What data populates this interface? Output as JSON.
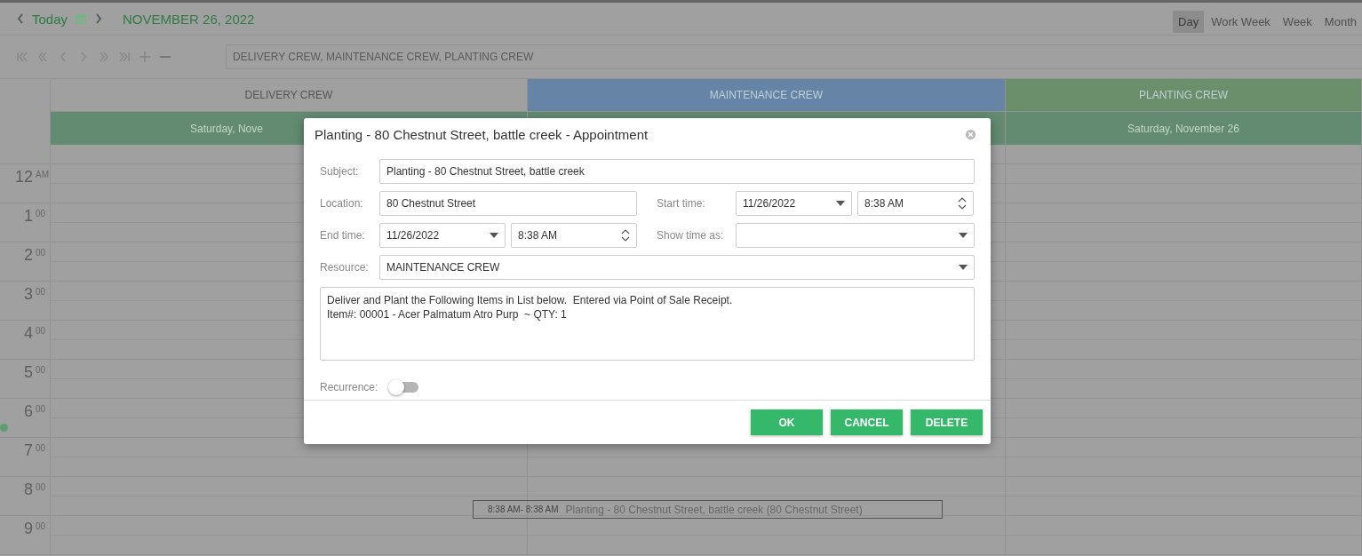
{
  "header": {
    "today": "Today",
    "date": "NOVEMBER 26, 2022",
    "views": [
      {
        "label": "Day",
        "selected": true
      },
      {
        "label": "Work Week",
        "selected": false
      },
      {
        "label": "Week",
        "selected": false
      },
      {
        "label": "Month",
        "selected": false
      }
    ]
  },
  "toolbar": {
    "resources": "DELIVERY CREW, MAINTENANCE CREW, PLANTING CREW"
  },
  "resources": [
    {
      "name": "DELIVERY CREW",
      "color": "#a0a0a0",
      "day_header": "Saturday, Nove"
    },
    {
      "name": "MAINTENANCE CREW",
      "color": "#6684a6"
    },
    {
      "name": "PLANTING CREW",
      "color": "#6a8f6a",
      "day_header": "Saturday, November 26"
    }
  ],
  "hours": [
    {
      "hour": "12",
      "suffix": "AM"
    },
    {
      "hour": "1",
      "suffix": "00"
    },
    {
      "hour": "2",
      "suffix": "00"
    },
    {
      "hour": "3",
      "suffix": "00"
    },
    {
      "hour": "4",
      "suffix": "00"
    },
    {
      "hour": "5",
      "suffix": "00"
    },
    {
      "hour": "6",
      "suffix": "00"
    },
    {
      "hour": "7",
      "suffix": "00"
    },
    {
      "hour": "8",
      "suffix": "00"
    },
    {
      "hour": "9",
      "suffix": "00"
    }
  ],
  "event": {
    "time": "8:38 AM- 8:38 AM",
    "title": "Planting - 80 Chestnut Street, battle creek (80 Chestnut Street)"
  },
  "dialog": {
    "title": "Planting - 80 Chestnut Street, battle creek - Appointment",
    "subject": {
      "label": "Subject:",
      "value": "Planting - 80 Chestnut Street, battle creek"
    },
    "location": {
      "label": "Location:",
      "value": "80 Chestnut Street"
    },
    "start": {
      "label": "Start time:",
      "date": "11/26/2022",
      "time": "8:38 AM"
    },
    "end": {
      "label": "End time:",
      "date": "11/26/2022",
      "time": "8:38 AM"
    },
    "show_time_as": {
      "label": "Show time as:"
    },
    "resource": {
      "label": "Resource:",
      "value": "MAINTENANCE CREW"
    },
    "description": "Deliver and Plant the Following Items in List below.  Entered via Point of Sale Receipt.\nItem#: 00001 - Acer Palmatum Atro Purp  ~ QTY: 1",
    "recurrence": {
      "label": "Recurrence:",
      "on": false
    },
    "buttons": [
      "OK",
      "CANCEL",
      "DELETE"
    ]
  }
}
